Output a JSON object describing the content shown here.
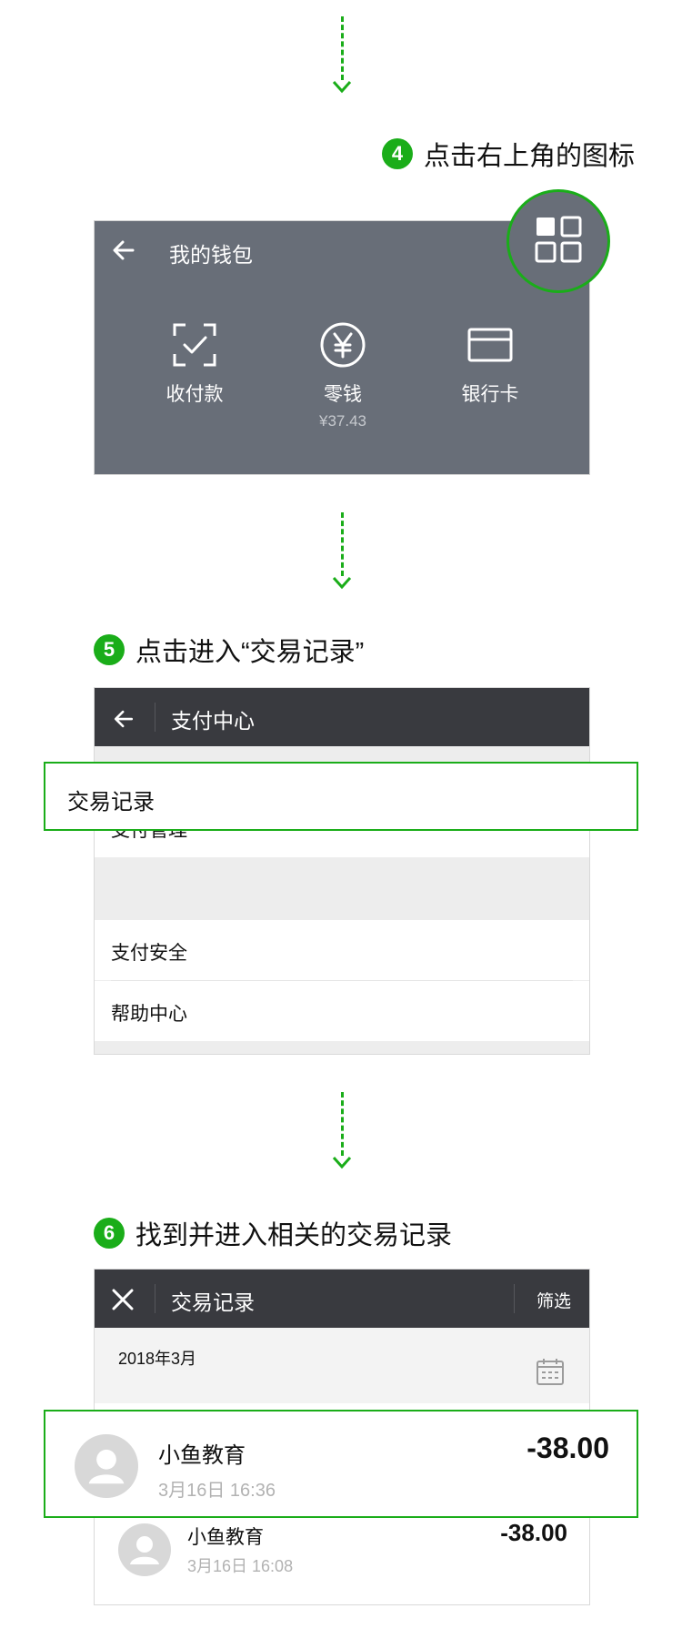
{
  "steps": [
    {
      "num": "4",
      "text": "点击右上角的图标"
    },
    {
      "num": "5",
      "text": "点击进入“交易记录”"
    },
    {
      "num": "6",
      "text": "找到并进入相关的交易记录"
    }
  ],
  "wallet": {
    "title": "我的钱包",
    "items": [
      {
        "label": "收付款",
        "icon": "scan-check-icon"
      },
      {
        "label": "零钱",
        "value": "¥37.43",
        "icon": "yuan-coin-icon"
      },
      {
        "label": "银行卡",
        "icon": "bank-card-icon"
      }
    ],
    "corner_icon": "grid-menu-icon"
  },
  "pay_center": {
    "title": "支付中心",
    "items": [
      "交易记录",
      "支付管理",
      "支付安全",
      "帮助中心"
    ]
  },
  "transactions": {
    "title": "交易记录",
    "filter": "筛选",
    "month": "2018年3月",
    "records": [
      {
        "name": "小鱼教育",
        "time": "3月16日 16:36",
        "amount": "-38.00"
      },
      {
        "name": "小鱼教育",
        "time": "3月16日 16:08",
        "amount": "-38.00"
      }
    ]
  },
  "colors": {
    "accent_green": "#1aad19",
    "wallet_bg": "#686e78",
    "navbar_bg": "#393a3f"
  }
}
